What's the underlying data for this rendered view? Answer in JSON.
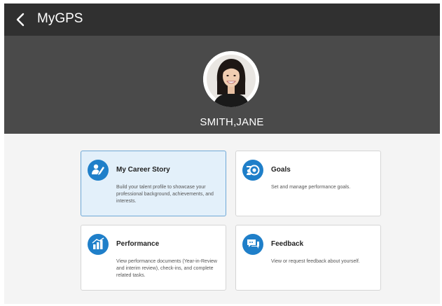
{
  "header": {
    "title": "MyGPS",
    "back_icon": "chevron-left-icon"
  },
  "profile": {
    "name": "SMITH,JANE",
    "avatar": "profile-photo"
  },
  "cards": [
    {
      "title": "My Career Story",
      "description": "Build your talent profile to showcase your professional background, achievements, and interests.",
      "icon": "career-story-icon",
      "selected": true
    },
    {
      "title": "Goals",
      "description": "Set and manage performance goals.",
      "icon": "goals-icon",
      "selected": false
    },
    {
      "title": "Performance",
      "description": "View performance documents (Year-in-Review and interim review), check-ins, and complete related tasks.",
      "icon": "performance-icon",
      "selected": false
    },
    {
      "title": "Feedback",
      "description": "View or request feedback about yourself.",
      "icon": "feedback-icon",
      "selected": false
    }
  ],
  "colors": {
    "topbar": "#303030",
    "hero": "#4a4a4a",
    "accent": "#1f7fc9",
    "selected_card": "#e3f0fa",
    "page_background": "#f4f4f4"
  }
}
